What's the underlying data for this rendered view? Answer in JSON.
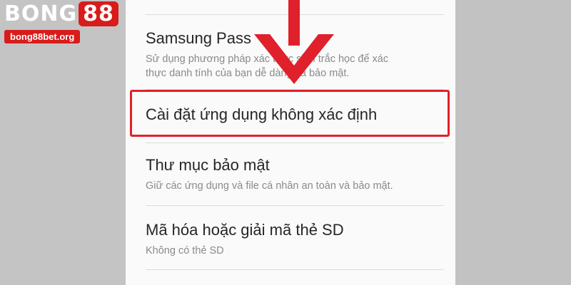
{
  "watermark": {
    "brand_prefix": "BONG",
    "brand_suffix": "88",
    "url": "bong88bet.org",
    "accent": "#d81b1b"
  },
  "settings_list": {
    "items": [
      {
        "title": "Samsung Pass",
        "subtitle_line1": "Sử dụng phương pháp xác thực sinh trắc học để xác",
        "subtitle_line2": "thực danh tính của bạn dễ dàng và bảo mật."
      },
      {
        "title": "Cài đặt ứng dụng không xác định"
      },
      {
        "title": "Thư mục bảo mật",
        "subtitle_line1": "Giữ các ứng dụng và file cá nhân an toàn và bảo mật."
      },
      {
        "title": "Mã hóa hoặc giải mã thẻ SD",
        "subtitle_line1": "Không có thẻ SD"
      }
    ]
  },
  "annotation": {
    "highlight_color": "#e0202a",
    "arrow_icon": "arrow-down-icon"
  }
}
